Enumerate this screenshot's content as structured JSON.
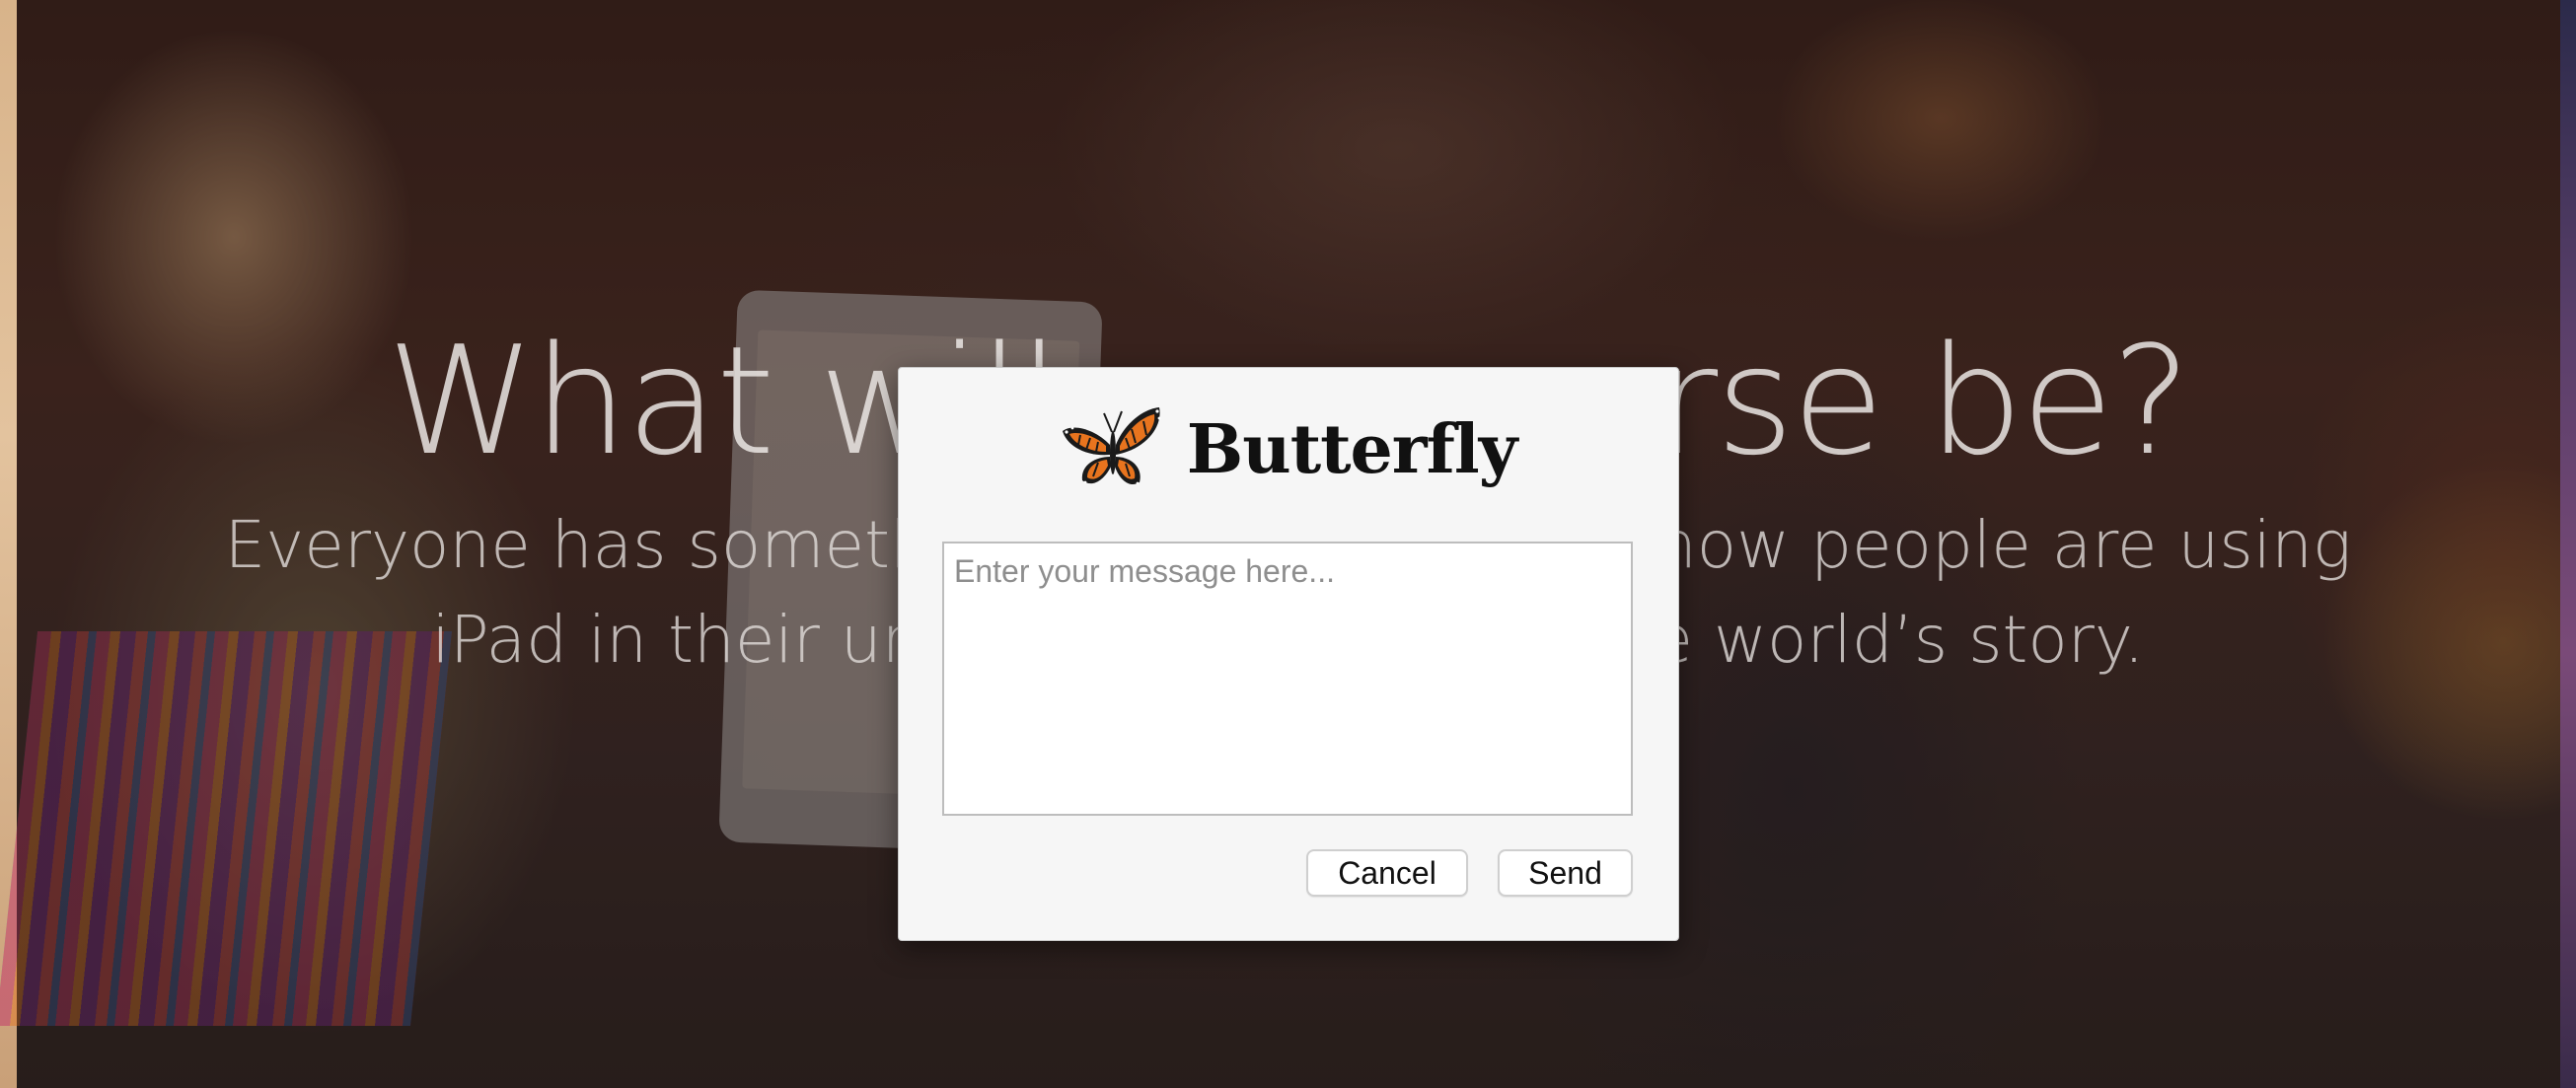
{
  "hero": {
    "title": "What will your verse be?",
    "subtitle_line1": "Everyone has something to contribute. See how people are using",
    "subtitle_line2": "iPad in their unique ways to add to the world’s story."
  },
  "dialog": {
    "title": "Butterfly",
    "logo_icon": "butterfly-icon",
    "message_placeholder": "Enter your message here...",
    "message_value": "",
    "cancel_label": "Cancel",
    "send_label": "Send"
  },
  "colors": {
    "dialog_background": "#f6f6f6",
    "butterfly_orange": "#e8741e",
    "butterfly_black": "#1a1a1a"
  }
}
